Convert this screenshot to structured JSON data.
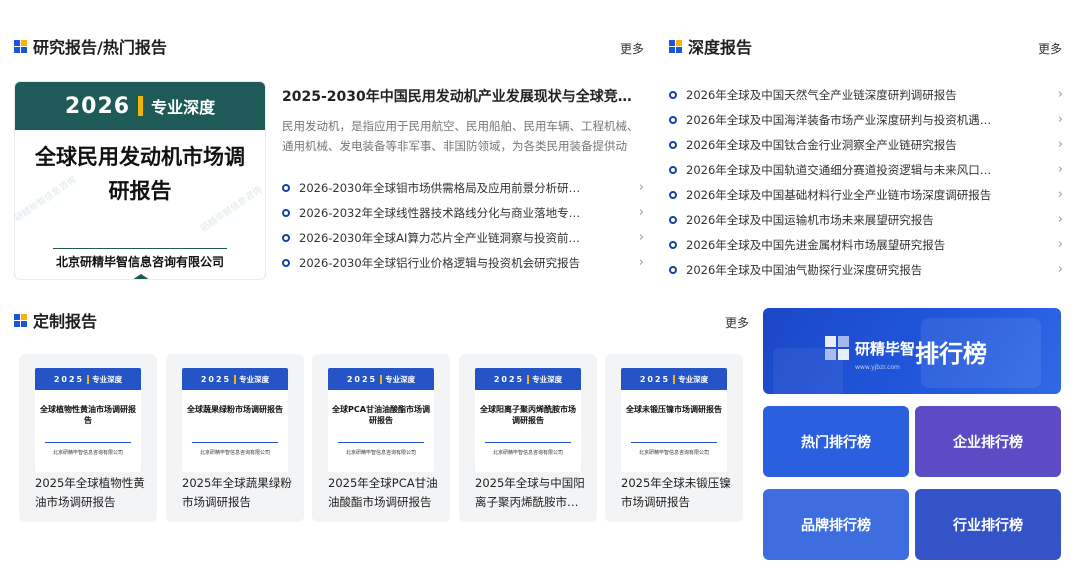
{
  "research": {
    "title": "研究报告/热门报告",
    "more": "更多",
    "feature": {
      "cover": {
        "year": "2026",
        "tag": "专业深度",
        "title": "全球民用发动机市场调研报告",
        "company": "北京研精毕智信息咨询有限公司"
      },
      "title": "2025-2030年中国民用发动机产业发展现状与全球竞…",
      "desc": "民用发动机，是指应用于民用航空、民用船舶、民用车辆、工程机械、通用机械、发电装备等非军事、非国防领域，为各类民用装备提供动力…"
    },
    "items": [
      "2026-2030年全球钼市场供需格局及应用前景分析研…",
      "2026-2032年全球线性器技术路线分化与商业落地专…",
      "2026-2030年全球AI算力芯片全产业链洞察与投资前…",
      "2026-2030年全球铝行业价格逻辑与投资机会研究报告"
    ]
  },
  "depth": {
    "title": "深度报告",
    "more": "更多",
    "items": [
      "2026年全球及中国天然气全产业链深度研判调研报告",
      "2026年全球及中国海洋装备市场产业深度研判与投资机遇…",
      "2026年全球及中国钛合金行业洞察全产业链研究报告",
      "2026年全球及中国轨道交通细分赛道投资逻辑与未来风口…",
      "2026年全球及中国基础材料行业全产业链市场深度调研报告",
      "2026年全球及中国运输机市场未来展望研究报告",
      "2026年全球及中国先进金属材料市场展望研究报告",
      "2026年全球及中国油气勘探行业深度研究报告"
    ]
  },
  "custom": {
    "title": "定制报告",
    "more": "更多",
    "cards": [
      {
        "year": "2025",
        "tag": "专业深度",
        "cover_title": "全球植物性黄油市场调研报告",
        "company": "北京研精毕智信息咨询有限公司",
        "title": "2025年全球植物性黄油市场调研报告"
      },
      {
        "year": "2025",
        "tag": "专业深度",
        "cover_title": "全球蔬果绿粉市场调研报告",
        "company": "北京研精毕智信息咨询有限公司",
        "title": "2025年全球蔬果绿粉市场调研报告"
      },
      {
        "year": "2025",
        "tag": "专业深度",
        "cover_title": "全球PCA甘油油酸酯市场调研报告",
        "company": "北京研精毕智信息咨询有限公司",
        "title": "2025年全球PCA甘油油酸酯市场调研报告"
      },
      {
        "year": "2025",
        "tag": "专业深度",
        "cover_title": "全球阳离子聚丙烯酰胺市场调研报告",
        "company": "北京研精毕智信息咨询有限公司",
        "title": "2025年全球与中国阳离子聚丙烯酰胺市…"
      },
      {
        "year": "2025",
        "tag": "专业深度",
        "cover_title": "全球未锻压镍市场调研报告",
        "company": "北京研精毕智信息咨询有限公司",
        "title": "2025年全球未锻压镍市场调研报告"
      }
    ]
  },
  "rankings": {
    "logo_text": "研精毕智",
    "logo_url": "www.yjbzr.com",
    "banner_title": "排行榜",
    "buttons": [
      {
        "label": "热门排行榜",
        "color": "#2a5fe0"
      },
      {
        "label": "企业排行榜",
        "color": "#5b4bc4"
      },
      {
        "label": "品牌排行榜",
        "color": "#3d6ddf"
      },
      {
        "label": "行业排行榜",
        "color": "#3553c9"
      }
    ]
  }
}
